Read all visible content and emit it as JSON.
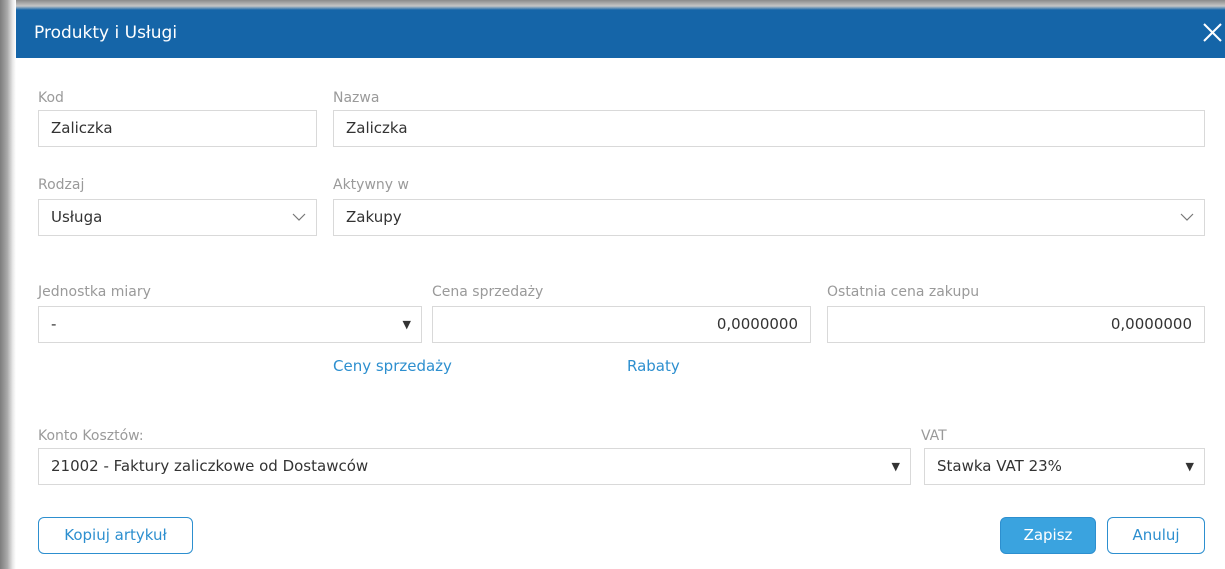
{
  "dialog": {
    "title": "Produkty i Usługi",
    "close_icon": "close-icon"
  },
  "fields": {
    "kod": {
      "label": "Kod",
      "value": "Zaliczka"
    },
    "nazwa": {
      "label": "Nazwa",
      "value": "Zaliczka"
    },
    "rodzaj": {
      "label": "Rodzaj",
      "value": "Usługa"
    },
    "aktywny": {
      "label": "Aktywny w",
      "value": "Zakupy"
    },
    "jednostka": {
      "label": "Jednostka miary",
      "value": "-"
    },
    "cena_sprzedazy": {
      "label": "Cena sprzedaży",
      "value": "0,0000000"
    },
    "ostatnia_cena": {
      "label": "Ostatnia cena zakupu",
      "value": "0,0000000"
    },
    "konto": {
      "label": "Konto Kosztów:",
      "value": "21002 - Faktury zaliczkowe od Dostawców"
    },
    "vat": {
      "label": "VAT",
      "value": "Stawka VAT 23%"
    }
  },
  "links": {
    "ceny_sprzedazy": "Ceny sprzedaży",
    "rabaty": "Rabaty"
  },
  "buttons": {
    "kopiuj": "Kopiuj artykuł",
    "zapisz": "Zapisz",
    "anuluj": "Anuluj"
  },
  "glyphs": {
    "caret": "▼"
  },
  "colors": {
    "titlebar": "#1565a8",
    "accent": "#2d8fcf",
    "primary_button": "#3aa3df",
    "label": "#9a9a9a",
    "border": "#d9d9d9"
  }
}
